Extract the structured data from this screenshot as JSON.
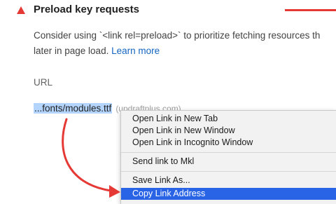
{
  "audit": {
    "title": "Preload key requests",
    "description_line1": "Consider using `<link rel=preload>` to prioritize fetching resources th",
    "description_line2": "later in page load. ",
    "learn_more": "Learn more",
    "url_column_header": "URL",
    "status_color": "#e53935"
  },
  "table": {
    "rows": [
      {
        "url": "...fonts/modules.ttf",
        "domain": "(updraftplus.com)"
      }
    ]
  },
  "context_menu": {
    "items": [
      {
        "label": "Open Link in New Tab"
      },
      {
        "label": "Open Link in New Window"
      },
      {
        "label": "Open Link in Incognito Window"
      },
      {
        "label": "Send link to Mkl"
      },
      {
        "label": "Save Link As..."
      },
      {
        "label": "Copy Link Address",
        "selected": true
      }
    ],
    "highlight_color": "#2a64e6"
  },
  "icons": {
    "status": "warning-triangle-icon",
    "annotation": "red-curved-arrow-icon"
  }
}
